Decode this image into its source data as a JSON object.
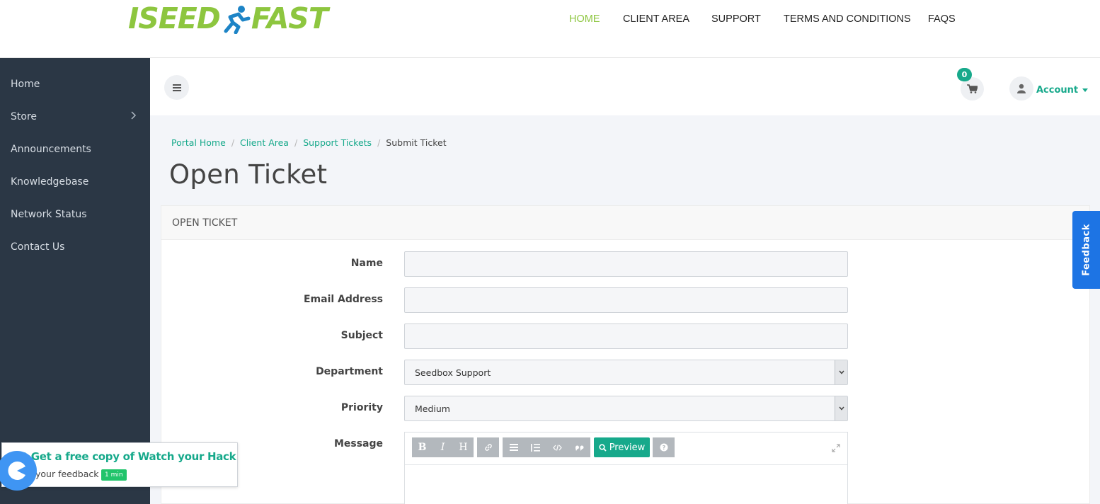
{
  "brand": {
    "logo_part1": "ISEED",
    "logo_part2": "FAST",
    "logo_color": "#8dc63f"
  },
  "topnav": {
    "items": [
      {
        "label": "HOME",
        "active": true
      },
      {
        "label": "CLIENT AREA"
      },
      {
        "label": "SUPPORT"
      },
      {
        "label": "TERMS AND CONDITIONS"
      },
      {
        "label": "FAQS"
      }
    ]
  },
  "sidebar": {
    "items": [
      {
        "label": "Home"
      },
      {
        "label": "Store",
        "icon": "chevron-right-icon"
      },
      {
        "label": "Announcements"
      },
      {
        "label": "Knowledgebase"
      },
      {
        "label": "Network Status"
      },
      {
        "label": "Contact Us"
      }
    ]
  },
  "header": {
    "cart_count": "0",
    "account_label": "Account",
    "accent_color": "#17a98b"
  },
  "breadcrumb": {
    "items": [
      "Portal Home",
      "Client Area",
      "Support Tickets"
    ],
    "current": "Submit Ticket"
  },
  "page": {
    "title": "Open Ticket"
  },
  "form": {
    "panel_title": "OPEN TICKET",
    "name_label": "Name",
    "name_value": "",
    "email_label": "Email Address",
    "email_value": "",
    "subject_label": "Subject",
    "subject_value": "",
    "department_label": "Department",
    "department_value": "Seedbox Support",
    "priority_label": "Priority",
    "priority_value": "Medium",
    "message_label": "Message",
    "editor": {
      "bold": "B",
      "italic": "I",
      "heading": "H",
      "preview_label": "Preview"
    }
  },
  "feedback_tab": {
    "label": "Feedback",
    "color": "#1d74e4"
  },
  "promo": {
    "title": "t Get a free copy of Watch your Hack",
    "subtitle": "your feedback",
    "badge": "1 min"
  }
}
